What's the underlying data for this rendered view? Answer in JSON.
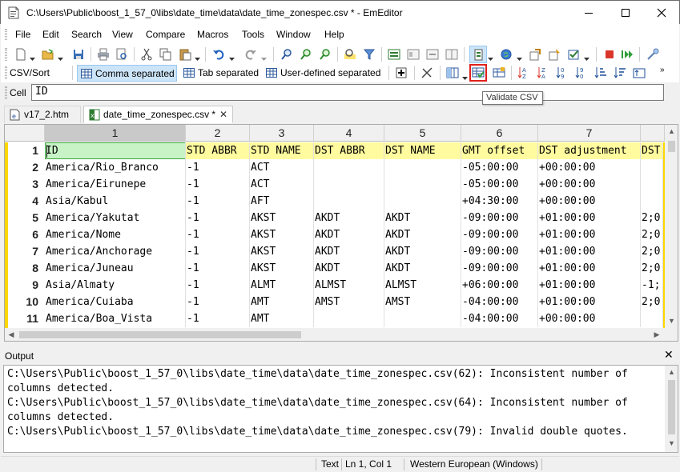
{
  "window": {
    "title": "C:\\Users\\Public\\boost_1_57_0\\libs\\date_time\\data\\date_time_zonespec.csv * - EmEditor"
  },
  "menu": [
    "File",
    "Edit",
    "Search",
    "View",
    "Compare",
    "Macros",
    "Tools",
    "Window",
    "Help"
  ],
  "csv_toolbar": {
    "label": "CSV/Sort",
    "modes": [
      "Comma separated",
      "Tab separated",
      "User-defined separated"
    ],
    "active_mode": "Comma separated"
  },
  "cell_bar": {
    "label": "Cell",
    "value": "ID"
  },
  "tooltip": "Validate CSV",
  "tabs": [
    {
      "label": "v17_2.htm",
      "icon": "html-file-icon",
      "active": false
    },
    {
      "label": "date_time_zonespec.csv *",
      "icon": "csv-file-icon",
      "active": true
    }
  ],
  "grid": {
    "columns": [
      "1",
      "2",
      "3",
      "4",
      "5",
      "6",
      "7",
      ""
    ],
    "rows": [
      {
        "n": "1",
        "cells": [
          "ID",
          "STD ABBR",
          "STD NAME",
          "DST ABBR",
          "DST NAME",
          "GMT offset",
          "DST adjustment",
          "DST"
        ]
      },
      {
        "n": "2",
        "cells": [
          "America/Rio_Branco",
          "-1",
          "ACT",
          "",
          "",
          "-05:00:00",
          "+00:00:00",
          ""
        ]
      },
      {
        "n": "3",
        "cells": [
          "America/Eirunepe",
          "-1",
          "ACT",
          "",
          "",
          "-05:00:00",
          "+00:00:00",
          ""
        ]
      },
      {
        "n": "4",
        "cells": [
          "Asia/Kabul",
          "-1",
          "AFT",
          "",
          "",
          "+04:30:00",
          "+00:00:00",
          ""
        ]
      },
      {
        "n": "5",
        "cells": [
          "America/Yakutat",
          "-1",
          "AKST",
          "AKDT",
          "AKDT",
          "-09:00:00",
          "+01:00:00",
          "2;0"
        ]
      },
      {
        "n": "6",
        "cells": [
          "America/Nome",
          "-1",
          "AKST",
          "AKDT",
          "AKDT",
          "-09:00:00",
          "+01:00:00",
          "2;0"
        ]
      },
      {
        "n": "7",
        "cells": [
          "America/Anchorage",
          "-1",
          "AKST",
          "AKDT",
          "AKDT",
          "-09:00:00",
          "+01:00:00",
          "2;0"
        ]
      },
      {
        "n": "8",
        "cells": [
          "America/Juneau",
          "-1",
          "AKST",
          "AKDT",
          "AKDT",
          "-09:00:00",
          "+01:00:00",
          "2;0"
        ]
      },
      {
        "n": "9",
        "cells": [
          "Asia/Almaty",
          "-1",
          "ALMT",
          "ALMST",
          "ALMST",
          "+06:00:00",
          "+01:00:00",
          "-1;"
        ]
      },
      {
        "n": "10",
        "cells": [
          "America/Cuiaba",
          "-1",
          "AMT",
          "AMST",
          "AMST",
          "-04:00:00",
          "+01:00:00",
          "2;0"
        ]
      },
      {
        "n": "11",
        "cells": [
          "America/Boa_Vista",
          "-1",
          "AMT",
          "",
          "",
          "-04:00:00",
          "+00:00:00",
          ""
        ]
      }
    ]
  },
  "output": {
    "title": "Output",
    "lines": [
      "C:\\Users\\Public\\boost_1_57_0\\libs\\date_time\\data\\date_time_zonespec.csv(62): Inconsistent number of",
      "columns detected.",
      "C:\\Users\\Public\\boost_1_57_0\\libs\\date_time\\data\\date_time_zonespec.csv(64): Inconsistent number of",
      "columns detected.",
      "C:\\Users\\Public\\boost_1_57_0\\libs\\date_time\\data\\date_time_zonespec.csv(79): Invalid double quotes."
    ]
  },
  "status": {
    "mode": "Text",
    "position": "Ln 1, Col 1",
    "encoding": "Western European (Windows)"
  },
  "colors": {
    "header_row": "#fffb9e",
    "selected_cell": "#c7f3c7",
    "gutter_marker": "#ffd700",
    "tooltip_highlight": "#e0201b",
    "active_mode": "#cce4f7"
  }
}
